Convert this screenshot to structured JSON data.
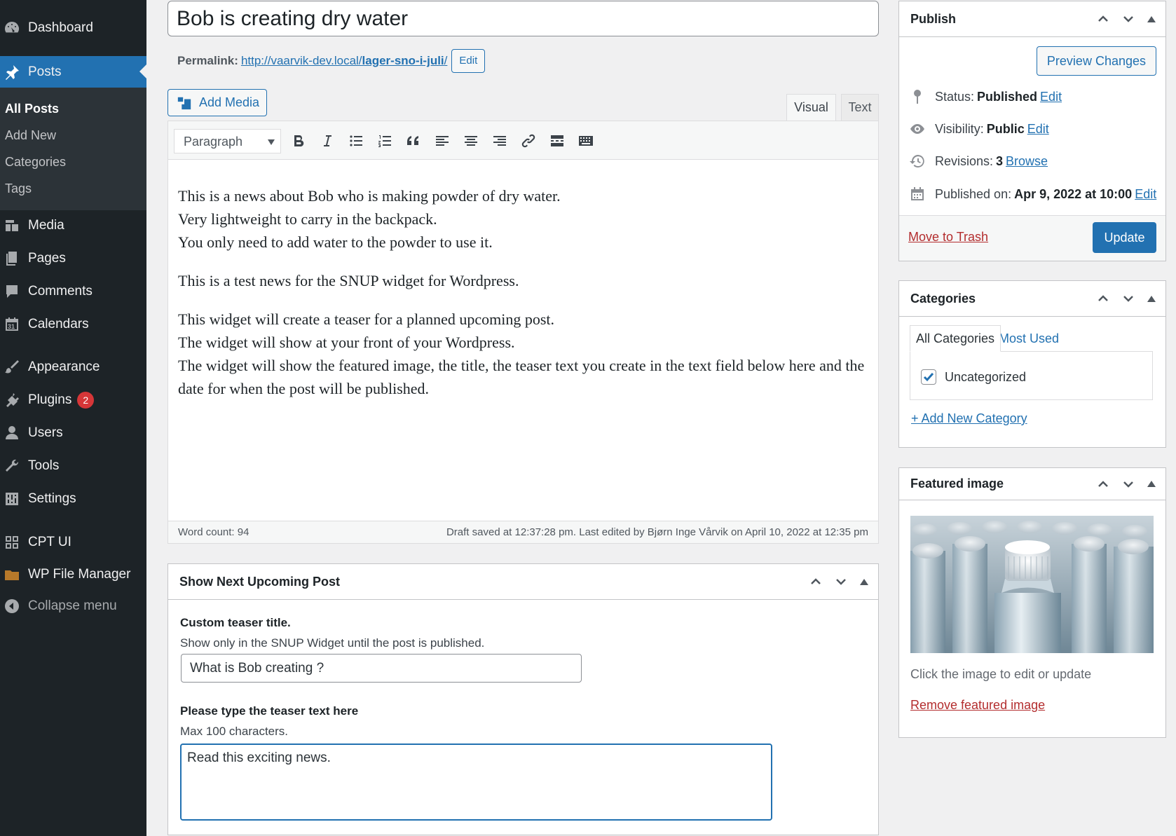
{
  "sidebar": {
    "items": [
      {
        "label": "Dashboard",
        "icon": "dashboard-icon"
      },
      {
        "label": "Posts",
        "icon": "pushpin-icon"
      },
      {
        "label": "Media",
        "icon": "media-icon"
      },
      {
        "label": "Pages",
        "icon": "pages-icon"
      },
      {
        "label": "Comments",
        "icon": "comment-icon"
      },
      {
        "label": "Calendars",
        "icon": "calendar-icon"
      },
      {
        "label": "Appearance",
        "icon": "brush-icon"
      },
      {
        "label": "Plugins",
        "icon": "plugin-icon",
        "badge": "2"
      },
      {
        "label": "Users",
        "icon": "user-icon"
      },
      {
        "label": "Tools",
        "icon": "wrench-icon"
      },
      {
        "label": "Settings",
        "icon": "settings-icon"
      },
      {
        "label": "CPT UI",
        "icon": "grid-icon"
      },
      {
        "label": "WP File Manager",
        "icon": "folder-icon"
      },
      {
        "label": "Collapse menu",
        "icon": "collapse-icon"
      }
    ],
    "submenu": [
      "All Posts",
      "Add New",
      "Categories",
      "Tags"
    ]
  },
  "post": {
    "title": "Bob is creating dry water",
    "permalink_label": "Permalink:",
    "permalink_base": "http://vaarvik-dev.local/",
    "permalink_slug": "lager-sno-i-juli",
    "permalink_trail": "/",
    "edit_label": "Edit"
  },
  "editor": {
    "add_media": "Add Media",
    "tab_visual": "Visual",
    "tab_text": "Text",
    "format": "Paragraph",
    "paragraphs": [
      [
        "This is a news about Bob who is making powder of dry water.",
        "Very lightweight to carry in the backpack.",
        "You only need to add water to the powder to use it."
      ],
      [
        "This is a test news for the SNUP widget for Wordpress."
      ],
      [
        "This widget will create a teaser for a planned upcoming post.",
        "The widget will show at your front of your Wordpress.",
        "The widget will show the featured image, the title, the teaser text you create in the text field below here and the date for when the post will be published."
      ]
    ],
    "word_count": "Word count: 94",
    "draft_status": "Draft saved at 12:37:28 pm. Last edited by Bjørn Inge Vårvik on April 10, 2022 at 12:35 pm"
  },
  "snup": {
    "title": "Show Next Upcoming Post",
    "teaser_title_label": "Custom teaser title.",
    "teaser_title_desc": "Show only in the SNUP Widget until the post is published.",
    "teaser_title_value": "What is Bob creating ?",
    "teaser_text_label": "Please type the teaser text here",
    "teaser_text_desc": "Max 100 characters.",
    "teaser_text_value": "Read this exciting news."
  },
  "publish": {
    "title": "Publish",
    "preview": "Preview Changes",
    "status_label": "Status:",
    "status_value": "Published",
    "visibility_label": "Visibility:",
    "visibility_value": "Public",
    "revisions_label": "Revisions:",
    "revisions_value": "3",
    "browse": "Browse",
    "published_label": "Published on:",
    "published_value": "Apr 9, 2022 at 10:00",
    "edit": "Edit",
    "trash": "Move to Trash",
    "update": "Update"
  },
  "categories": {
    "title": "Categories",
    "tab_all": "All Categories",
    "tab_most": "Most Used",
    "items": [
      {
        "label": "Uncategorized",
        "checked": true
      }
    ],
    "add_new": "+ Add New Category"
  },
  "featured": {
    "title": "Featured image",
    "desc": "Click the image to edit or update",
    "remove": "Remove featured image"
  },
  "colors": {
    "accent": "#2271b1",
    "sidebar_bg": "#1d2327",
    "danger": "#b32d2e"
  }
}
